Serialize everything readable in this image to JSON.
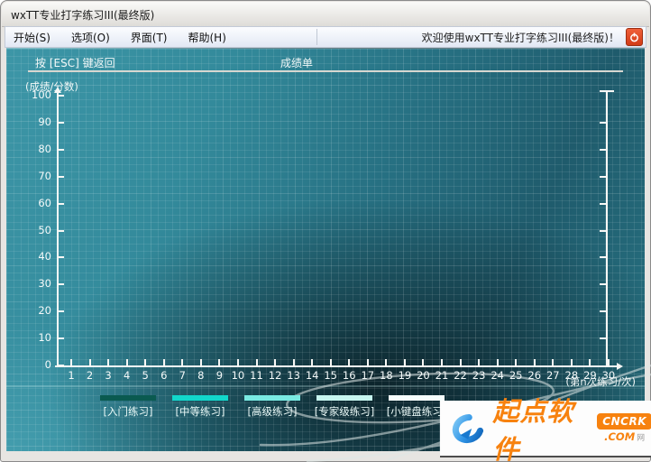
{
  "window": {
    "title": "wxTT专业打字练习III(最终版)",
    "menu": {
      "items": [
        {
          "label": "开始(S)"
        },
        {
          "label": "选项(O)"
        },
        {
          "label": "界面(T)"
        },
        {
          "label": "帮助(H)"
        }
      ],
      "welcome_text": "欢迎使用wxTT专业打字练习III(最终版)！",
      "power_button_icon": "power-icon"
    }
  },
  "header": {
    "esc_hint": "按 [ESC] 键返回",
    "sheet_title": "成绩单"
  },
  "chart_data": {
    "type": "line",
    "title": "成绩单",
    "ylabel": "(成绩/分数)",
    "xlabel": "(第n次练习/次)",
    "ylim": [
      0,
      100
    ],
    "xlim": [
      0,
      30
    ],
    "y_ticks": [
      0,
      10,
      20,
      30,
      40,
      50,
      60,
      70,
      80,
      90,
      100
    ],
    "x_ticks": [
      1,
      2,
      3,
      4,
      5,
      6,
      7,
      8,
      9,
      10,
      11,
      12,
      13,
      14,
      15,
      16,
      17,
      18,
      19,
      20,
      21,
      22,
      23,
      24,
      25,
      26,
      27,
      28,
      29,
      30
    ],
    "grid": true,
    "legend_position": "bottom",
    "series": [
      {
        "name": "[入门练习]",
        "color": "#0a5a50",
        "values": []
      },
      {
        "name": "[中等练习]",
        "color": "#12d7cb",
        "values": []
      },
      {
        "name": "[高级练习]",
        "color": "#79eae2",
        "values": []
      },
      {
        "name": "[专家级练习]",
        "color": "#c6f5ef",
        "values": []
      },
      {
        "name": "[小键盘练习]",
        "color": "#f6fefd",
        "values": []
      }
    ]
  },
  "legend": {
    "items": [
      {
        "label": "[入门练习]",
        "color": "#0a5a50"
      },
      {
        "label": "[中等练习]",
        "color": "#12d7cb"
      },
      {
        "label": "[高级练习]",
        "color": "#79eae2"
      },
      {
        "label": "[专家级练习]",
        "color": "#c6f5ef"
      },
      {
        "label": "[小键盘练习]",
        "color": "#f6fefd"
      }
    ]
  },
  "watermark": {
    "brand": "起点软件",
    "badge": "CNCRK",
    "domain": ".COM",
    "suffix": "网",
    "brand_color": "#f7820f",
    "logo_icon": "swoosh-circle-icon"
  },
  "colors": {
    "accent_teal": "#2a7a8c",
    "axis_white": "#f7f7f5",
    "power_red": "#d13b16"
  }
}
